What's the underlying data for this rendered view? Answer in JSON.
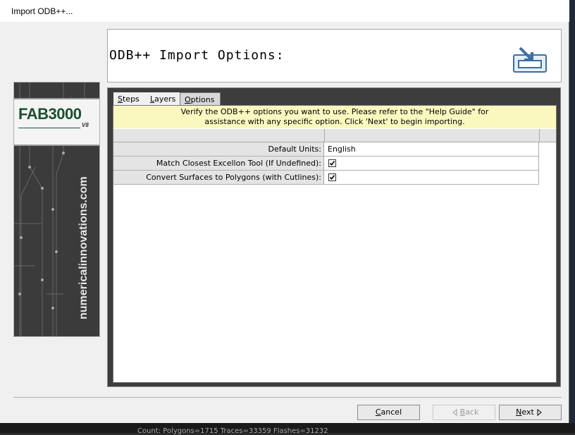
{
  "window": {
    "title": "Import ODB++..."
  },
  "header": {
    "title": "ODB++ Import Options:"
  },
  "sidebar": {
    "logo": "FAB3000",
    "version": "V8",
    "url": "numericalinnovations.com"
  },
  "tabs": [
    {
      "label": "Steps",
      "mnemonic": "S",
      "rest": "teps"
    },
    {
      "label": "Layers",
      "mnemonic": "L",
      "rest": "ayers"
    },
    {
      "label": "Options",
      "mnemonic": "O",
      "rest": "ptions",
      "active": true
    }
  ],
  "info": {
    "line1": "Verify the ODB++ options you want to use.  Please refer to the \"Help Guide\" for",
    "line2": "assistance with any specific option. Click 'Next' to begin importing."
  },
  "options": [
    {
      "label": "Default Units:",
      "value": "English",
      "type": "text"
    },
    {
      "label": "Match Closest Excellon Tool (If Undefined):",
      "checked": true,
      "type": "checkbox"
    },
    {
      "label": "Convert Surfaces to Polygons (with Cutlines):",
      "checked": true,
      "type": "checkbox"
    }
  ],
  "buttons": {
    "cancel": {
      "mnemonic": "C",
      "rest": "ancel"
    },
    "back": {
      "mnemonic": "B",
      "rest": "ack"
    },
    "next": {
      "mnemonic": "N",
      "rest": "ext"
    }
  },
  "status_behind": "Count: Polygons=1715 Traces=33359 Flashes=31232",
  "colors": {
    "info_bg": "#fbf8bf",
    "panel_bg": "#3d3d3d",
    "logo_green": "#1d4f2f"
  }
}
